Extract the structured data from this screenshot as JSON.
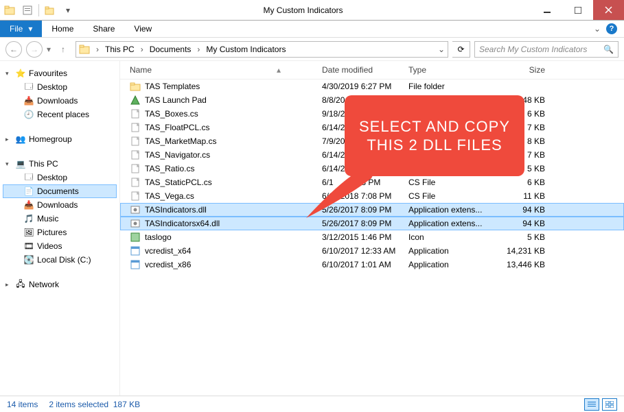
{
  "window": {
    "title": "My Custom Indicators"
  },
  "ribbon": {
    "file": "File",
    "home": "Home",
    "share": "Share",
    "view": "View"
  },
  "breadcrumb": {
    "root": "This PC",
    "p1": "Documents",
    "p2": "My Custom Indicators"
  },
  "search": {
    "placeholder": "Search My Custom Indicators"
  },
  "columns": {
    "name": "Name",
    "date": "Date modified",
    "type": "Type",
    "size": "Size"
  },
  "nav": {
    "favourites": "Favourites",
    "fav_desktop": "Desktop",
    "fav_downloads": "Downloads",
    "fav_recent": "Recent places",
    "homegroup": "Homegroup",
    "thispc": "This PC",
    "pc_desktop": "Desktop",
    "pc_documents": "Documents",
    "pc_downloads": "Downloads",
    "pc_music": "Music",
    "pc_pictures": "Pictures",
    "pc_videos": "Videos",
    "pc_localdisk": "Local Disk (C:)",
    "network": "Network"
  },
  "files": [
    {
      "name": "TAS Templates",
      "date": "4/30/2019 6:27 PM",
      "type": "File folder",
      "size": ""
    },
    {
      "name": "TAS Launch Pad",
      "date": "8/8/20",
      "type": "",
      "size": "48 KB"
    },
    {
      "name": "TAS_Boxes.cs",
      "date": "9/18/2",
      "type": "",
      "size": "6 KB"
    },
    {
      "name": "TAS_FloatPCL.cs",
      "date": "6/14/2",
      "type": "",
      "size": "7 KB"
    },
    {
      "name": "TAS_MarketMap.cs",
      "date": "7/9/20",
      "type": "",
      "size": "8 KB"
    },
    {
      "name": "TAS_Navigator.cs",
      "date": "6/14/2",
      "type": "",
      "size": "7 KB"
    },
    {
      "name": "TAS_Ratio.cs",
      "date": "6/14/2",
      "type": "",
      "size": "5 KB"
    },
    {
      "name": "TAS_StaticPCL.cs",
      "date": "6/1",
      "type": "CS File",
      "size": "6 KB",
      "date_suffix": "7:08 PM"
    },
    {
      "name": "TAS_Vega.cs",
      "date": "6/14/2018 7:08 PM",
      "type": "CS File",
      "size": "11 KB"
    },
    {
      "name": "TASIndicators.dll",
      "date": "5/26/2017 8:09 PM",
      "type": "Application extens...",
      "size": "94 KB",
      "selected": true
    },
    {
      "name": "TASIndicatorsx64.dll",
      "date": "5/26/2017 8:09 PM",
      "type": "Application extens...",
      "size": "94 KB",
      "selected": true
    },
    {
      "name": "taslogo",
      "date": "3/12/2015 1:46 PM",
      "type": "Icon",
      "size": "5 KB"
    },
    {
      "name": "vcredist_x64",
      "date": "6/10/2017 12:33 AM",
      "type": "Application",
      "size": "14,231 KB"
    },
    {
      "name": "vcredist_x86",
      "date": "6/10/2017 1:01 AM",
      "type": "Application",
      "size": "13,446 KB"
    }
  ],
  "status": {
    "count": "14 items",
    "selection": "2 items selected",
    "sel_size": "187 KB"
  },
  "callout": {
    "text": "SELECT AND COPY THIS 2 DLL FILES"
  }
}
